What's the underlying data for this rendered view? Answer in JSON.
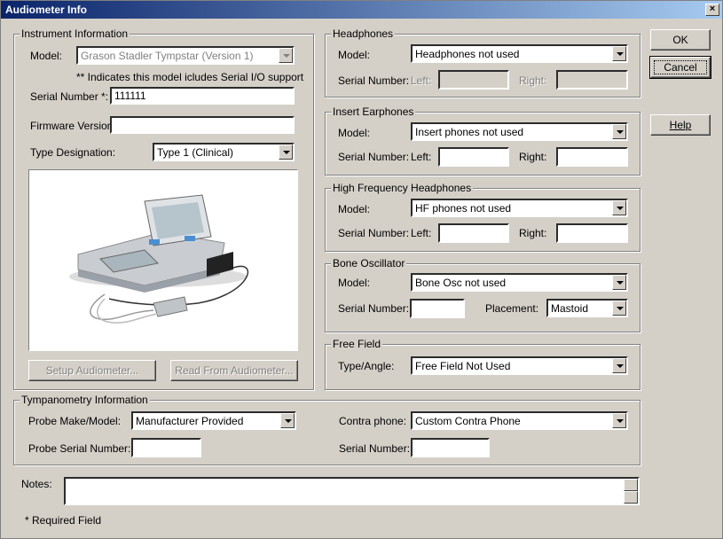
{
  "window": {
    "title": "Audiometer Info"
  },
  "buttons": {
    "ok": "OK",
    "cancel": "Cancel",
    "help": "Help",
    "setup": "Setup Audiometer...",
    "read": "Read From Audiometer..."
  },
  "instrument": {
    "legend": "Instrument Information",
    "model_label": "Model:",
    "model_value": "Grason Stadler Tympstar (Version 1)",
    "note": "** Indicates this model icludes Serial I/O support",
    "serial_label": "Serial Number *:",
    "serial_value": "111111",
    "firmware_label": "Firmware Version:",
    "firmware_value": "",
    "type_label": "Type Designation:",
    "type_value": "Type 1 (Clinical)"
  },
  "headphones": {
    "legend": "Headphones",
    "model_label": "Model:",
    "model_value": "Headphones not used",
    "serial_label": "Serial Number:",
    "left_label": "Left:",
    "right_label": "Right:"
  },
  "insert": {
    "legend": "Insert Earphones",
    "model_label": "Model:",
    "model_value": "Insert phones not used",
    "serial_label": "Serial Number:",
    "left_label": "Left:",
    "right_label": "Right:"
  },
  "hf": {
    "legend": "High Frequency Headphones",
    "model_label": "Model:",
    "model_value": "HF phones not used",
    "serial_label": "Serial Number:",
    "left_label": "Left:",
    "right_label": "Right:"
  },
  "bone": {
    "legend": "Bone Oscillator",
    "model_label": "Model:",
    "model_value": "Bone Osc not used",
    "serial_label": "Serial Number:",
    "placement_label": "Placement:",
    "placement_value": "Mastoid"
  },
  "freefield": {
    "legend": "Free Field",
    "type_label": "Type/Angle:",
    "type_value": "Free Field Not Used"
  },
  "tymp": {
    "legend": "Tympanometry Information",
    "probe_label": "Probe Make/Model:",
    "probe_value": "Manufacturer Provided",
    "probe_serial_label": "Probe Serial Number:",
    "contra_label": "Contra phone:",
    "contra_value": "Custom Contra Phone",
    "serial_label": "Serial Number:"
  },
  "notes": {
    "label": "Notes:",
    "value": ""
  },
  "footer": {
    "required": "* Required Field"
  }
}
